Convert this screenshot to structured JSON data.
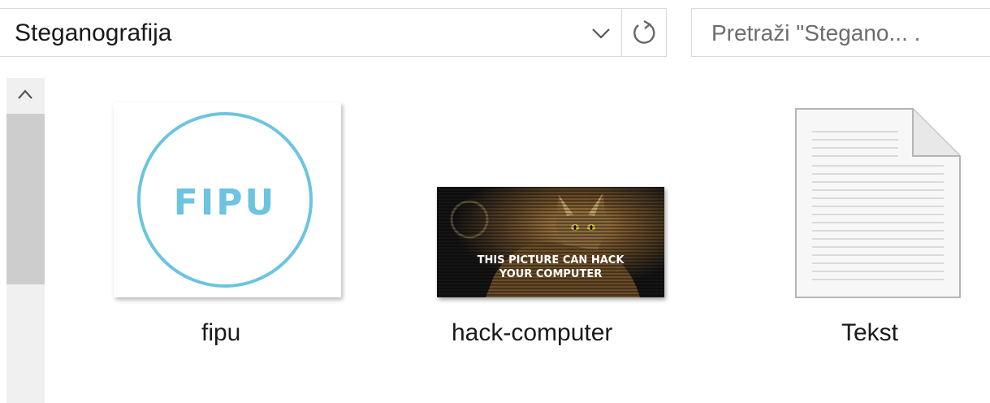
{
  "address_bar": {
    "path": "Steganografija"
  },
  "search": {
    "placeholder": "Pretraži \"Stegano... ."
  },
  "icons": {
    "dropdown": "chevron-down-icon",
    "refresh": "refresh-icon",
    "scroll_up": "chevron-up-icon"
  },
  "files": [
    {
      "name": "fipu",
      "thumbnail_text": "FIPU",
      "type": "image"
    },
    {
      "name": "hack-computer",
      "thumbnail_text_line1": "THIS PICTURE CAN HACK",
      "thumbnail_text_line2": "YOUR COMPUTER",
      "type": "image"
    },
    {
      "name": "Tekst",
      "type": "text-document"
    }
  ],
  "colors": {
    "fipu_accent": "#6cc4e0"
  }
}
